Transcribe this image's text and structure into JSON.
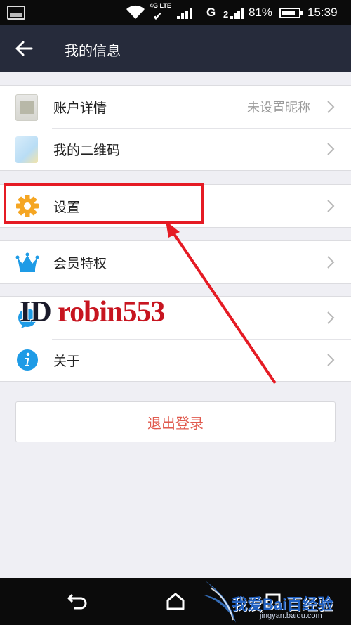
{
  "status_bar": {
    "network_label": "4G LTE",
    "carrier_g": "G",
    "battery_percent": "81%",
    "battery_level": 0.81,
    "time": "15:39"
  },
  "header": {
    "title": "我的信息"
  },
  "groups": [
    {
      "items": [
        {
          "label": "账户详情",
          "value": "未设置昵称",
          "icon": "avatar-icon"
        },
        {
          "label": "我的二维码",
          "value": "",
          "icon": "qr-code-icon"
        }
      ]
    },
    {
      "items": [
        {
          "label": "设置",
          "icon": "gear-icon"
        }
      ]
    },
    {
      "items": [
        {
          "label": "会员特权",
          "icon": "crown-icon"
        }
      ]
    },
    {
      "items": [
        {
          "label": "",
          "icon": "feedback-icon"
        },
        {
          "label": "关于",
          "icon": "info-icon"
        }
      ]
    }
  ],
  "overlay": {
    "watermark_id_prefix": "ID",
    "watermark_id_name": "robin553"
  },
  "logout": {
    "label": "退出登录"
  },
  "nav_bar": {
    "baidu_text": "我爱Bai百经验",
    "baidu_url": "jingyan.baidu.com"
  },
  "colors": {
    "title_bar": "#262b3b",
    "accent_orange": "#f5a623",
    "accent_blue": "#1e9be6",
    "highlight_red": "#e51b24",
    "logout_text": "#e05a4e"
  }
}
